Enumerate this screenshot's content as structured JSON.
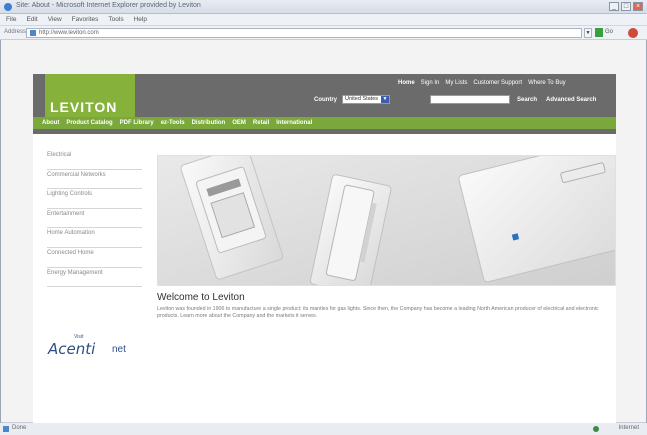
{
  "browser": {
    "title": "Site: About - Microsoft Internet Explorer provided by Leviton",
    "menu": [
      "File",
      "Edit",
      "View",
      "Favorites",
      "Tools",
      "Help"
    ],
    "address_label": "Address",
    "url": "http://www.leviton.com",
    "go_label": "Go",
    "status_text": "Done",
    "zone_text": "Internet"
  },
  "site": {
    "logo_text": "LEVITON",
    "top_nav": [
      "Home",
      "Sign In",
      "My Lists",
      "Customer Support",
      "Where To Buy"
    ],
    "country_label": "Country",
    "country_value": "United States",
    "search_label": "Search",
    "advanced_search_label": "Advanced Search",
    "main_nav": [
      "About",
      "Product Catalog",
      "PDF Library",
      "ez-Tools",
      "Distribution",
      "OEM",
      "Retail",
      "International"
    ],
    "side_nav": [
      "Electrical",
      "Commercial Networks",
      "Lighting Controls",
      "Entertainment",
      "Home Automation",
      "Connected Home",
      "Energy Management"
    ],
    "acenti": {
      "visit": "Visit",
      "word": "Acenti",
      "net": "net"
    },
    "welcome_title": "Welcome to Leviton",
    "welcome_body": "Leviton was founded in 1906 to manufacture a single product: its mantles for gas lights. Since then, the Company has become a leading North American producer of electrical and electronic products. Learn more about the Company and the markets it serves."
  }
}
